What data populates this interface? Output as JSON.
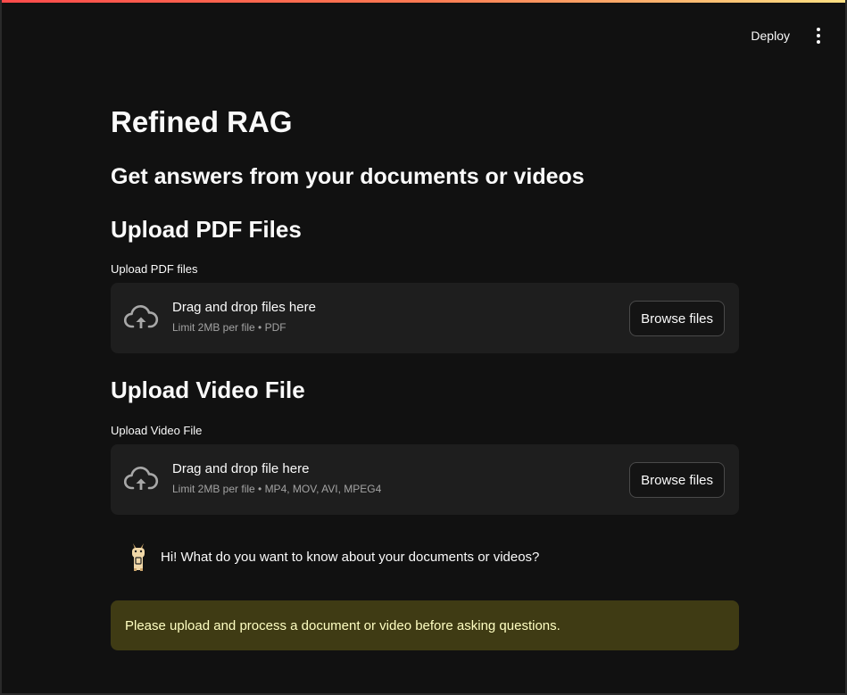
{
  "header": {
    "deploy_label": "Deploy",
    "menu_icon": "vertical-dots-icon"
  },
  "main": {
    "title": "Refined RAG",
    "subtitle": "Get answers from your documents or videos",
    "pdf_section": {
      "heading": "Upload PDF Files",
      "label": "Upload PDF files",
      "dropzone_text": "Drag and drop files here",
      "limit_text": "Limit 2MB per file • PDF",
      "browse_label": "Browse files",
      "icon": "cloud-upload-icon"
    },
    "video_section": {
      "heading": "Upload Video File",
      "label": "Upload Video File",
      "dropzone_text": "Drag and drop file here",
      "limit_text": "Limit 2MB per file • MP4, MOV, AVI, MPEG4",
      "browse_label": "Browse files",
      "icon": "cloud-upload-icon"
    },
    "chat": {
      "avatar_icon": "llama-avatar-icon",
      "message": "Hi! What do you want to know about your documents or videos?"
    },
    "warning": {
      "text": "Please upload and process a document or video before asking questions."
    }
  },
  "colors": {
    "background": "#111111",
    "dropzone_bg": "#1e1e1e",
    "warning_bg": "#3f3b14",
    "warning_text": "#ffffc2",
    "accent_gradient_start": "#ff4b4b",
    "accent_gradient_end": "#ffe083"
  }
}
